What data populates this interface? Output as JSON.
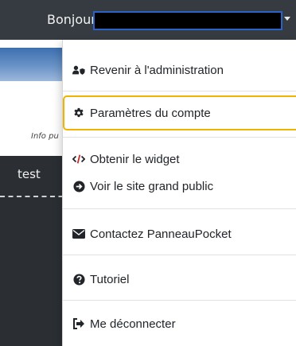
{
  "header": {
    "greeting": "Bonjour,"
  },
  "background": {
    "info_text": "Info pu",
    "panel_text": "test"
  },
  "menu": {
    "items": [
      {
        "label": "Revenir à l'administration",
        "icon": "user-shield-icon"
      },
      {
        "label": "Paramètres du compte",
        "icon": "gear-icon"
      },
      {
        "label": "Obtenir le widget",
        "icon": "code-icon"
      },
      {
        "label": "Voir le site grand public",
        "icon": "arrow-circle-right-icon"
      },
      {
        "label": "Contactez PanneauPocket",
        "icon": "envelope-icon"
      },
      {
        "label": "Tutoriel",
        "icon": "question-circle-icon"
      },
      {
        "label": "Me déconnecter",
        "icon": "sign-out-icon"
      }
    ]
  },
  "colors": {
    "topbar": "#353b40",
    "highlight_border": "#f0b400",
    "name_box_border": "#2a63c7"
  }
}
